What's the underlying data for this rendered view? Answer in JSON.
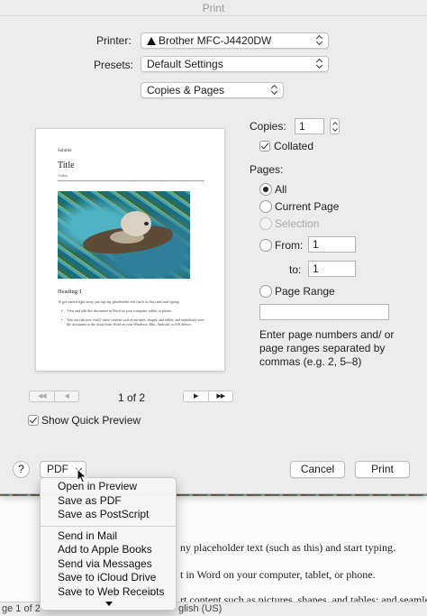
{
  "window": {
    "title": "Print"
  },
  "printer": {
    "label": "Printer:",
    "value": "Brother MFC-J4420DW"
  },
  "presets": {
    "label": "Presets:",
    "value": "Default Settings"
  },
  "section": {
    "value": "Copies & Pages"
  },
  "preview": {
    "subtitle": "Subtitle",
    "title": "Title",
    "author": "Author",
    "heading": "Heading 1",
    "intro": "To get started right away, just tap any placeholder text (such as this) and start typing.",
    "bullet1": "View and edit this document in Word on your computer, tablet, or phone.",
    "bullet2": "You can edit text; easily insert content such as pictures, shapes, and tables; and seamlessly save the document to the cloud from Word on your Windows, Mac, Android, or iOS device.",
    "image_alt": "sea otter floating in water"
  },
  "pager": {
    "first_label": "◀◀",
    "prev_label": "◀",
    "status": "1 of 2",
    "next_label": "▶",
    "last_label": "▶▶"
  },
  "show_preview": {
    "label": "Show Quick Preview",
    "checked": true
  },
  "copies": {
    "label": "Copies:",
    "value": "1"
  },
  "collated": {
    "label": "Collated",
    "checked": true
  },
  "pages": {
    "label": "Pages:",
    "all": "All",
    "current": "Current Page",
    "selection": "Selection",
    "from_label": "From:",
    "from_value": "1",
    "to_label": "to:",
    "to_value": "1",
    "range_label": "Page Range",
    "range_value": "",
    "hint": "Enter page numbers and/ or page ranges separated by commas (e.g. 2, 5–8)",
    "selected": "All"
  },
  "footer": {
    "help": "?",
    "pdf": "PDF",
    "cancel": "Cancel",
    "print": "Print"
  },
  "pdf_menu": {
    "group1": [
      "Open in Preview",
      "Save as PDF",
      "Save as PostScript"
    ],
    "group2": [
      "Send in Mail",
      "Add to Apple Books",
      "Send via Messages",
      "Save to iCloud Drive",
      "Save to Web Receipts"
    ]
  },
  "background_doc": {
    "line1": "ny placeholder text (such as this) and start typing.",
    "line2": "t in Word on your computer, tablet, or phone.",
    "line3": "rt content such as pictures, shapes, and tables; and seamlessly",
    "status_left": "ge 1 of 2",
    "status_lang": "glish (US)"
  },
  "icons": {
    "printer_warning": "warning-triangle-icon",
    "menu_more": "chevron-down-icon",
    "cursor": "pointer-cursor-icon"
  }
}
